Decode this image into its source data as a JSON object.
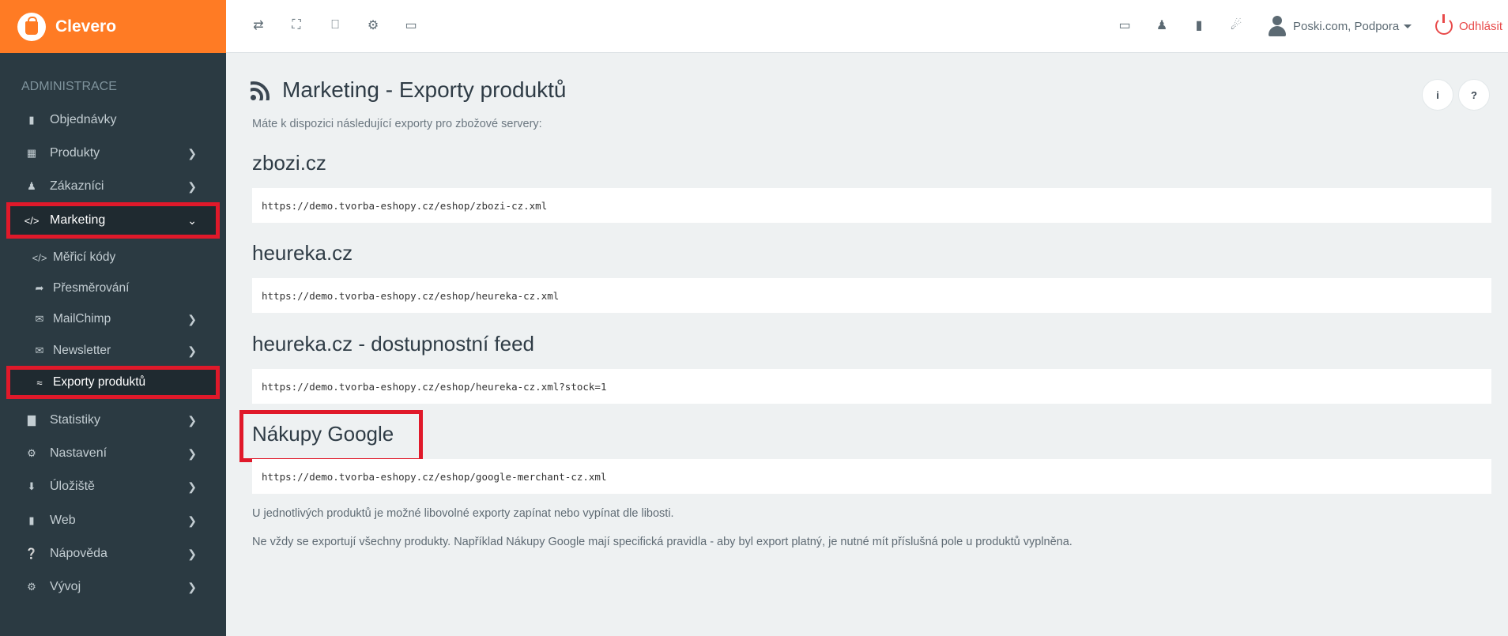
{
  "brand": {
    "name": "Clevero"
  },
  "sidebar": {
    "section_title": "ADMINISTRACE",
    "items": [
      {
        "label": "Objednávky",
        "icon": "book-icon"
      },
      {
        "label": "Produkty",
        "icon": "grid-icon"
      },
      {
        "label": "Zákazníci",
        "icon": "person-icon"
      },
      {
        "label": "Marketing",
        "icon": "code-icon"
      },
      {
        "label": "Měřicí kódy",
        "icon": "code-icon"
      },
      {
        "label": "Přesměrování",
        "icon": "share-icon"
      },
      {
        "label": "MailChimp",
        "icon": "envelope-icon"
      },
      {
        "label": "Newsletter",
        "icon": "envelope-icon"
      },
      {
        "label": "Exporty produktů",
        "icon": "rss-icon"
      },
      {
        "label": "Statistiky",
        "icon": "bar-chart-icon"
      },
      {
        "label": "Nastavení",
        "icon": "gear-icon"
      },
      {
        "label": "Úložiště",
        "icon": "download-icon"
      },
      {
        "label": "Web",
        "icon": "file-icon"
      },
      {
        "label": "Nápověda",
        "icon": "question-icon"
      },
      {
        "label": "Vývoj",
        "icon": "cogs-icon"
      }
    ]
  },
  "topbar": {
    "user_name": "Poski.com, Podpora",
    "logout_label": "Odhlásit"
  },
  "page": {
    "title": "Marketing - Exporty produktů",
    "subtitle": "Máte k dispozici následující exporty pro zbožové servery:",
    "info_btn": "i",
    "help_btn": "?"
  },
  "feeds": [
    {
      "name": "zbozi.cz",
      "url": "https://demo.tvorba-eshopy.cz/eshop/zbozi-cz.xml"
    },
    {
      "name": "heureka.cz",
      "url": "https://demo.tvorba-eshopy.cz/eshop/heureka-cz.xml"
    },
    {
      "name": "heureka.cz - dostupnostní feed",
      "url": "https://demo.tvorba-eshopy.cz/eshop/heureka-cz.xml?stock=1"
    },
    {
      "name": "Nákupy Google",
      "url": "https://demo.tvorba-eshopy.cz/eshop/google-merchant-cz.xml"
    }
  ],
  "notes": [
    "U jednotlivých produktů je možné libovolné exporty zapínat nebo vypínat dle libosti.",
    "Ne vždy se exportují všechny produkty. Například Nákupy Google mají specifická pravidla - aby byl export platný, je nutné mít příslušná pole u produktů vyplněna."
  ],
  "colors": {
    "brand": "#ff7b24",
    "sidebar": "#2b3a42",
    "highlight": "#e0192a",
    "logout": "#e84a4a"
  }
}
